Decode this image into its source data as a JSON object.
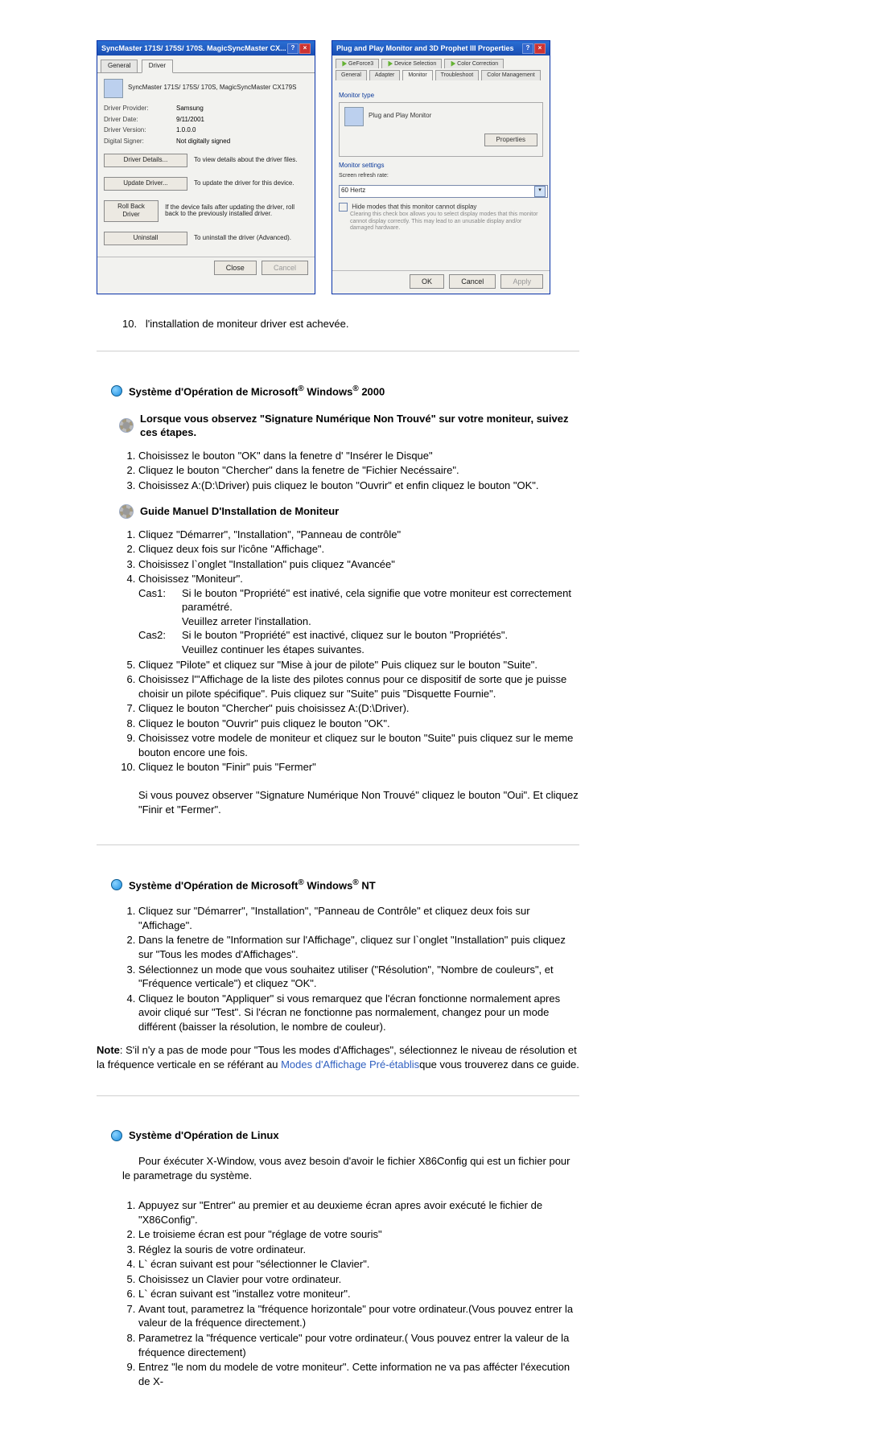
{
  "shots": {
    "driverWin": {
      "title": "SyncMaster 171S/ 175S/ 170S. MagicSyncMaster CX...",
      "tabs": [
        "General",
        "Driver"
      ],
      "monitorName": "SyncMaster 171S/ 175S/ 170S, MagicSyncMaster CX179S",
      "rows": [
        {
          "label": "Driver Provider:",
          "value": "Samsung"
        },
        {
          "label": "Driver Date:",
          "value": "9/11/2001"
        },
        {
          "label": "Driver Version:",
          "value": "1.0.0.0"
        },
        {
          "label": "Digital Signer:",
          "value": "Not digitally signed"
        }
      ],
      "buttons": [
        {
          "label": "Driver Details...",
          "desc": "To view details about the driver files."
        },
        {
          "label": "Update Driver...",
          "desc": "To update the driver for this device."
        },
        {
          "label": "Roll Back Driver",
          "desc": "If the device fails after updating the driver, roll back to the previously installed driver."
        },
        {
          "label": "Uninstall",
          "desc": "To uninstall the driver (Advanced)."
        }
      ],
      "footer": {
        "close": "Close",
        "cancel": "Cancel"
      }
    },
    "propWin": {
      "title": "Plug and Play Monitor and 3D Prophet III Properties",
      "tabs1": [
        {
          "label": "GeForce3",
          "nv": true
        },
        {
          "label": "Device Selection",
          "nv": true
        },
        {
          "label": "Color Correction",
          "nv": true
        }
      ],
      "tabs2": [
        {
          "label": "General"
        },
        {
          "label": "Adapter"
        },
        {
          "label": "Monitor",
          "active": true
        },
        {
          "label": "Troubleshoot"
        },
        {
          "label": "Color Management"
        }
      ],
      "monitorTypeLbl": "Monitor type",
      "monitorName": "Plug and Play Monitor",
      "propBtn": "Properties",
      "monitorSettingsLbl": "Monitor settings",
      "refreshLbl": "Screen refresh rate:",
      "refreshValue": "60 Hertz",
      "hideChk": "Hide modes that this monitor cannot display",
      "hideDesc": "Clearing this check box allows you to select display modes that this monitor cannot display correctly. This may lead to an unusable display and/or damaged hardware.",
      "footer": {
        "ok": "OK",
        "cancel": "Cancel",
        "apply": "Apply"
      }
    }
  },
  "item10": "l'installation de moniteur driver est achevée.",
  "w2000": {
    "title_a": "Système d'Opération de Microsoft",
    "title_b": " Windows",
    "title_c": " 2000",
    "sub1": "Lorsque vous observez \"Signature Numérique Non Trouvé\" sur votre moniteur, suivez ces étapes.",
    "l1": [
      "Choisissez le bouton \"OK\" dans la fenetre d' \"Insérer le Disque\"",
      "Cliquez le bouton \"Chercher\" dans la fenetre de \"Fichier Necéssaire\".",
      "Choisissez A:(D:\\Driver) puis cliquez le bouton \"Ouvrir\" et enfin cliquez le bouton \"OK\"."
    ],
    "sub2": "Guide Manuel D'Installation de Moniteur",
    "g": {
      "i1": "Cliquez \"Démarrer\", \"Installation\", \"Panneau de contrôle\"",
      "i2": "Cliquez deux fois sur l'icône \"Affichage\".",
      "i3": "Choisissez l`onglet \"Installation\" puis cliquez \"Avancée\"",
      "i4": "Choisissez \"Moniteur\".",
      "c1k": "Cas1:",
      "c1a": "Si le bouton \"Propriété\" est inativé, cela signifie que votre moniteur est correctement paramétré.",
      "c1b": "Veuillez arreter l'installation.",
      "c2k": "Cas2:",
      "c2a": "Si le bouton \"Propriété\" est inactivé, cliquez sur le bouton \"Propriétés\".",
      "c2b": "Veuillez continuer les étapes suivantes.",
      "i5": "Cliquez \"Pilote\" et cliquez sur \"Mise à jour de pilote\" Puis cliquez sur le bouton \"Suite\".",
      "i6": "Choisissez l'\"Affichage de la liste des pilotes connus pour ce dispositif de sorte que je puisse choisir un pilote spécifique\". Puis cliquez sur \"Suite\" puis \"Disquette Fournie\".",
      "i7": "Cliquez le bouton \"Chercher\" puis choisissez A:(D:\\Driver).",
      "i8": "Cliquez le bouton \"Ouvrir\" puis cliquez le bouton \"OK\".",
      "i9": "Choisissez votre modele de moniteur et cliquez sur le bouton \"Suite\" puis cliquez sur le meme bouton encore une fois.",
      "i10": "Cliquez le bouton \"Finir\" puis \"Fermer\"",
      "i10b": "Si vous pouvez observer \"Signature Numérique Non Trouvé\" cliquez le bouton \"Oui\". Et cliquez \"Finir et \"Fermer\"."
    }
  },
  "wnt": {
    "title_c": " NT",
    "l": [
      "Cliquez sur \"Démarrer\", \"Installation\", \"Panneau de Contrôle\" et cliquez deux fois sur \"Affichage\".",
      "Dans la fenetre de \"Information sur l'Affichage\", cliquez sur l`onglet \"Installation\" puis cliquez sur \"Tous les modes d'Affichages\".",
      "Sélectionnez un mode que vous souhaitez utiliser (\"Résolution\", \"Nombre de couleurs\", et \"Fréquence verticale\") et cliquez \"OK\".",
      "Cliquez le bouton \"Appliquer\" si vous remarquez que l'écran fonctionne normalement apres avoir cliqué sur \"Test\". Si l'écran ne fonctionne pas normalement, changez pour un mode différent (baisser la résolution, le nombre de couleur)."
    ],
    "note_a": "Note",
    "note_b": ": S'il n'y a pas de mode pour \"Tous les modes d'Affichages\", sélectionnez le niveau de résolution et la fréquence verticale en se référant au ",
    "note_link": "Modes d'Affichage Pré-établis",
    "note_c": "que vous trouverez dans ce guide."
  },
  "linux": {
    "title": "Système d'Opération de Linux",
    "intro": "Pour éxécuter X-Window, vous avez besoin d'avoir le fichier X86Config qui est un fichier pour le parametrage du système.",
    "l": [
      "Appuyez sur \"Entrer\" au premier et au deuxieme écran apres avoir exécuté le fichier de \"X86Config\".",
      "Le troisieme écran est pour \"réglage de votre souris\"",
      "Réglez la souris de votre ordinateur.",
      "L` écran suivant est pour \"sélectionner le Clavier\".",
      "Choisissez un Clavier pour votre ordinateur.",
      "L` écran suivant est \"installez votre moniteur\".",
      "Avant tout, parametrez la \"fréquence horizontale\" pour votre ordinateur.(Vous pouvez entrer la valeur de la fréquence directement.)",
      "Parametrez la \"fréquence verticale\" pour votre ordinateur.( Vous pouvez entrer la valeur de la fréquence directement)",
      "Entrez \"le nom du modele de votre moniteur\". Cette information ne va pas affécter l'éxecution de X-"
    ]
  }
}
